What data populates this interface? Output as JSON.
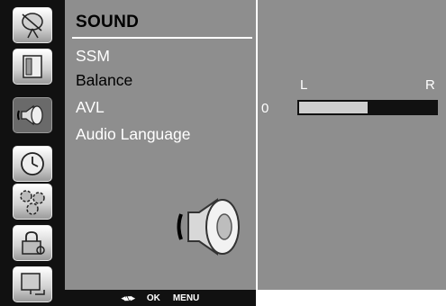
{
  "menu": {
    "title": "SOUND",
    "items": [
      "SSM",
      "Balance",
      "AVL",
      "Audio Language"
    ],
    "selected_index": 1
  },
  "sidebar_icons": [
    "satellite-dish-icon",
    "picture-frame-icon",
    "speaker-icon",
    "clock-icon",
    "gears-icon",
    "lock-icon",
    "input-monitor-icon"
  ],
  "hint_bar": {
    "ok_label": "OK",
    "menu_label": "MENU"
  },
  "balance": {
    "left_label": "L",
    "right_label": "R",
    "value_label": "0",
    "fill_fraction": 0.5
  },
  "colors": {
    "panel": "#8e8e8e",
    "dark": "#111111",
    "fill": "#cfcfcf"
  }
}
